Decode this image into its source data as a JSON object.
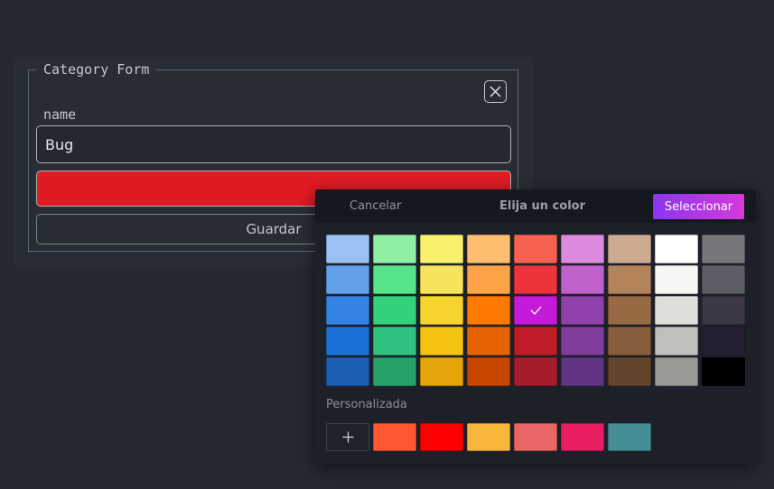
{
  "form": {
    "legend": "Category Form",
    "name_label": "name",
    "name_value": "Bug",
    "selected_color": "#e01b24",
    "save_label": "Guardar"
  },
  "picker": {
    "cancel_label": "Cancelar",
    "title": "Elija un color",
    "select_label": "Seleccionar",
    "custom_label": "Personalizada",
    "selected_swatch": "#c61ad9",
    "palette": [
      "#99c1f1",
      "#8ff0a4",
      "#f9f06b",
      "#ffbe6f",
      "#f66151",
      "#dc8add",
      "#cdab8f",
      "#ffffff",
      "#77767b",
      "#62a0ea",
      "#57e389",
      "#f8e45c",
      "#ffa348",
      "#ed333b",
      "#c061cb",
      "#b5835a",
      "#f6f5f4",
      "#5e5c64",
      "#3584e4",
      "#33d17a",
      "#f6d32d",
      "#ff7800",
      "#c61ad9",
      "#9141ac",
      "#986a44",
      "#deddda",
      "#3d3846",
      "#1c71d8",
      "#2ec27e",
      "#f5c211",
      "#e66100",
      "#c01c28",
      "#813d9c",
      "#865e3c",
      "#c0bfbc",
      "#241f31",
      "#1a5fb4",
      "#26a269",
      "#e5a50a",
      "#c64600",
      "#a51d2d",
      "#613583",
      "#63452c",
      "#9a9996",
      "#000000"
    ],
    "custom_colors": [
      "#ff5733",
      "#ff0000",
      "#f7b73a",
      "#e86666",
      "#e91e63",
      "#448e96"
    ]
  }
}
